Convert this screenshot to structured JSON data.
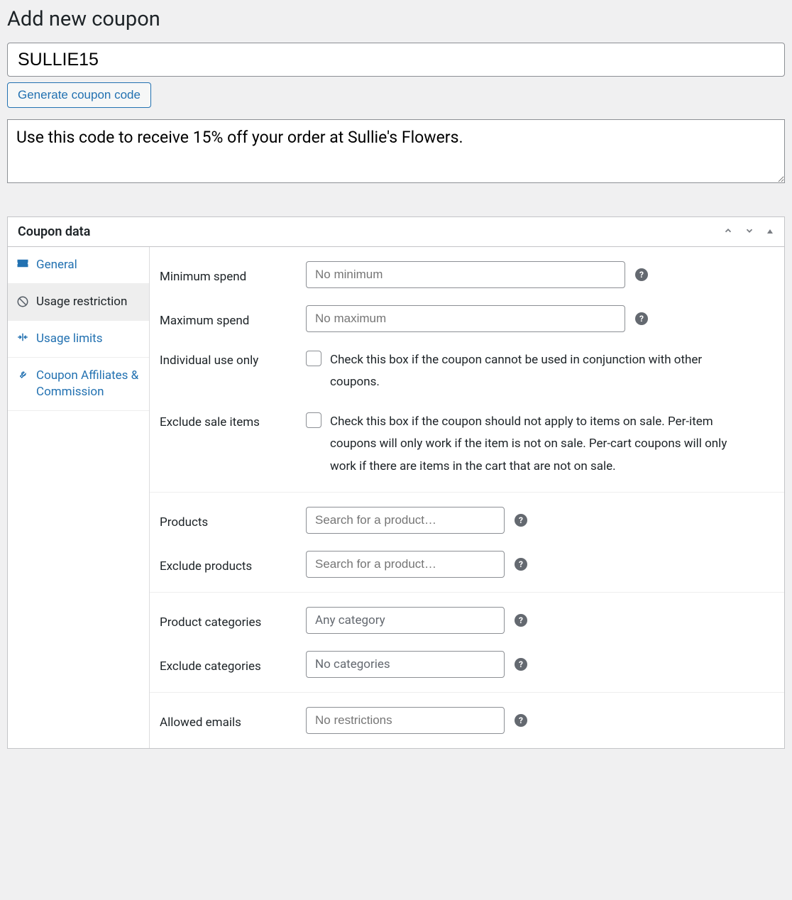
{
  "page_title": "Add new coupon",
  "coupon_code": "SULLIE15",
  "generate_button": "Generate coupon code",
  "description": "Use this code to receive 15% off your order at Sullie's Flowers.",
  "panel": {
    "title": "Coupon data",
    "tabs": [
      {
        "label": "General"
      },
      {
        "label": "Usage restriction"
      },
      {
        "label": "Usage limits"
      },
      {
        "label": "Coupon Affiliates & Commission"
      }
    ],
    "fields": {
      "min_spend": {
        "label": "Minimum spend",
        "placeholder": "No minimum"
      },
      "max_spend": {
        "label": "Maximum spend",
        "placeholder": "No maximum"
      },
      "individual_use": {
        "label": "Individual use only",
        "desc": "Check this box if the coupon cannot be used in conjunction with other coupons."
      },
      "exclude_sale": {
        "label": "Exclude sale items",
        "desc": "Check this box if the coupon should not apply to items on sale. Per-item coupons will only work if the item is not on sale. Per-cart coupons will only work if there are items in the cart that are not on sale."
      },
      "products": {
        "label": "Products",
        "placeholder": "Search for a product…"
      },
      "exclude_products": {
        "label": "Exclude products",
        "placeholder": "Search for a product…"
      },
      "product_categories": {
        "label": "Product categories",
        "placeholder": "Any category"
      },
      "exclude_categories": {
        "label": "Exclude categories",
        "placeholder": "No categories"
      },
      "allowed_emails": {
        "label": "Allowed emails",
        "placeholder": "No restrictions"
      }
    }
  }
}
